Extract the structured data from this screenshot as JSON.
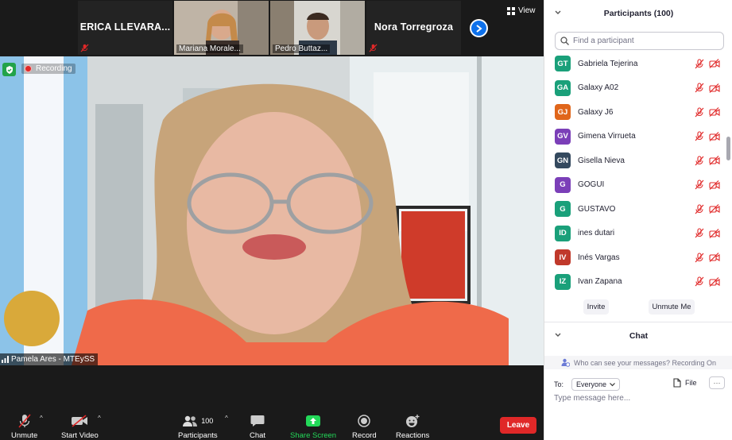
{
  "gallery": {
    "tiles": [
      {
        "name": "ERICA  LLEVARA..."
      },
      {
        "caption": "Mariana Morale..."
      },
      {
        "caption": "Pedro Buttaz..."
      },
      {
        "name": "Nora Torregroza"
      }
    ],
    "view_label": "View"
  },
  "main_video": {
    "speaker_name": "Pamela Ares - MTEySS",
    "recording_label": "Recording"
  },
  "toolbar": {
    "unmute_label": "Unmute",
    "start_video_label": "Start Video",
    "participants_label": "Participants",
    "participants_count": "100",
    "chat_label": "Chat",
    "share_screen_label": "Share Screen",
    "record_label": "Record",
    "reactions_label": "Reactions",
    "leave_label": "Leave",
    "share_color": "#23d959",
    "leave_color": "#e02828"
  },
  "participants": {
    "header": "Participants (100)",
    "search_placeholder": "Find a participant",
    "list": [
      {
        "initials": "GT",
        "name": "Gabriela Tejerina",
        "color": "#1aa07a"
      },
      {
        "initials": "GA",
        "name": "Galaxy A02",
        "color": "#1aa07a"
      },
      {
        "initials": "GJ",
        "name": "Galaxy J6",
        "color": "#e0661b"
      },
      {
        "initials": "GV",
        "name": "Gimena Virrueta",
        "color": "#7b3fb8"
      },
      {
        "initials": "GN",
        "name": "Gisella Nieva",
        "color": "#34495e"
      },
      {
        "initials": "G",
        "name": "GOGUI",
        "color": "#7b3fb8"
      },
      {
        "initials": "G",
        "name": "GUSTAVO",
        "color": "#1aa07a"
      },
      {
        "initials": "ID",
        "name": "ines dutari",
        "color": "#1aa07a"
      },
      {
        "initials": "IV",
        "name": "Inés Vargas",
        "color": "#c0392b"
      },
      {
        "initials": "IZ",
        "name": "Ivan Zapana",
        "color": "#1aa07a"
      }
    ],
    "invite_label": "Invite",
    "unmute_me_label": "Unmute Me"
  },
  "chat": {
    "header": "Chat",
    "info": "Who can see your messages? Recording On",
    "to_label": "To:",
    "recipient": "Everyone",
    "file_label": "File",
    "more_label": "···",
    "message_placeholder": "Type message here..."
  }
}
